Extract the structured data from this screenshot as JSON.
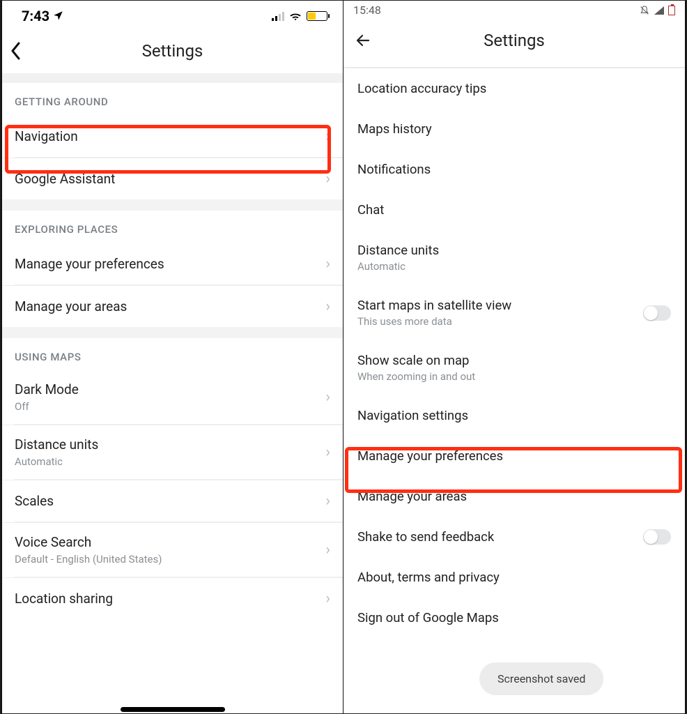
{
  "ios": {
    "status": {
      "time": "7:43"
    },
    "header": {
      "title": "Settings"
    },
    "sections": {
      "getting_around": {
        "header": "GETTING AROUND",
        "items": [
          {
            "label": "Navigation"
          },
          {
            "label": "Google Assistant"
          }
        ]
      },
      "exploring_places": {
        "header": "EXPLORING PLACES",
        "items": [
          {
            "label": "Manage your preferences"
          },
          {
            "label": "Manage your areas"
          }
        ]
      },
      "using_maps": {
        "header": "USING MAPS",
        "items": [
          {
            "label": "Dark Mode",
            "sub": "Off"
          },
          {
            "label": "Distance units",
            "sub": "Automatic"
          },
          {
            "label": "Scales"
          },
          {
            "label": "Voice Search",
            "sub": "Default - English (United States)"
          },
          {
            "label": "Location sharing"
          }
        ]
      }
    }
  },
  "android": {
    "status": {
      "time": "15:48"
    },
    "header": {
      "title": "Settings"
    },
    "items": [
      {
        "label": "Location accuracy tips"
      },
      {
        "label": "Maps history"
      },
      {
        "label": "Notifications"
      },
      {
        "label": "Chat"
      },
      {
        "label": "Distance units",
        "sub": "Automatic"
      },
      {
        "label": "Start maps in satellite view",
        "sub": "This uses more data",
        "toggle": false
      },
      {
        "label": "Show scale on map",
        "sub": "When zooming in and out"
      },
      {
        "label": "Navigation settings"
      },
      {
        "label": "Manage your preferences"
      },
      {
        "label": "Manage your areas"
      },
      {
        "label": "Shake to send feedback",
        "toggle": false
      },
      {
        "label": "About, terms and privacy"
      },
      {
        "label": "Sign out of Google Maps"
      }
    ],
    "toast": "Screenshot saved"
  }
}
